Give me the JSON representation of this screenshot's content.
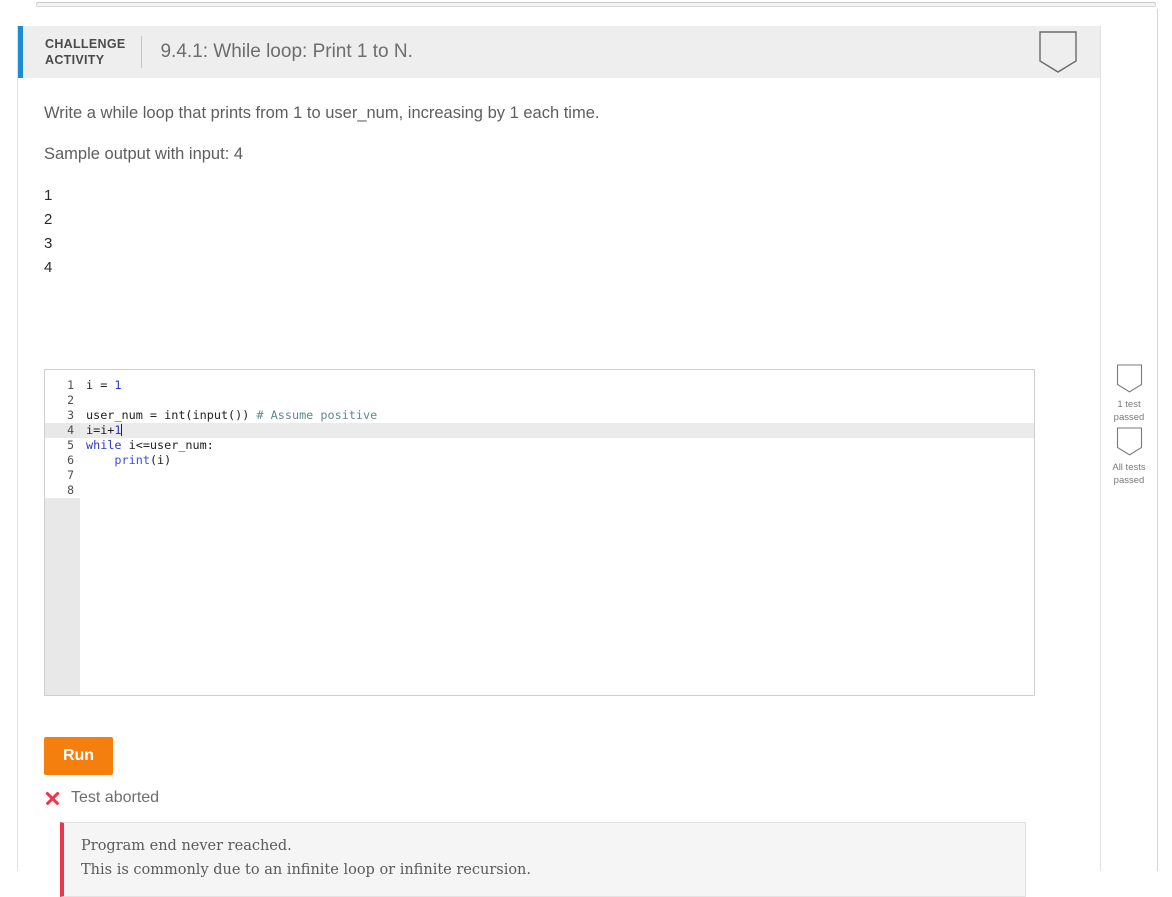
{
  "header": {
    "kicker_line1": "CHALLENGE",
    "kicker_line2": "ACTIVITY",
    "title": "9.4.1: While loop: Print 1 to N.",
    "trophy_icon": "banner-badge-icon"
  },
  "instructions": {
    "prompt": "Write a while loop that prints from 1 to user_num, increasing by 1 each time.",
    "sample_label": "Sample output with input: 4",
    "sample_output": [
      "1",
      "2",
      "3",
      "4"
    ]
  },
  "editor": {
    "line_numbers": [
      "1",
      "2",
      "3",
      "4",
      "5",
      "6",
      "7",
      "8"
    ],
    "active_line": 4,
    "lines": [
      {
        "n": 1,
        "segments": [
          {
            "t": "i = ",
            "c": "plain"
          },
          {
            "t": "1",
            "c": "num"
          }
        ]
      },
      {
        "n": 2,
        "segments": []
      },
      {
        "n": 3,
        "segments": [
          {
            "t": "user_num = int(input()) ",
            "c": "plain"
          },
          {
            "t": "# Assume positive",
            "c": "com"
          }
        ]
      },
      {
        "n": 4,
        "segments": [
          {
            "t": "i=i+",
            "c": "plain"
          },
          {
            "t": "1",
            "c": "num"
          }
        ]
      },
      {
        "n": 5,
        "segments": [
          {
            "t": "while",
            "c": "kw"
          },
          {
            "t": " i<=user_num:",
            "c": "plain"
          }
        ]
      },
      {
        "n": 6,
        "segments": [
          {
            "t": "    ",
            "c": "plain"
          },
          {
            "t": "print",
            "c": "fn"
          },
          {
            "t": "(i)",
            "c": "plain"
          }
        ]
      },
      {
        "n": 7,
        "segments": []
      },
      {
        "n": 8,
        "segments": []
      }
    ]
  },
  "toolbar": {
    "run_label": "Run"
  },
  "result": {
    "status_icon": "x-mark-icon",
    "status_text": "Test aborted",
    "error_line1": "Program end never reached.",
    "error_line2": "This is commonly due to an infinite loop or infinite recursion."
  },
  "badges": [
    {
      "icon": "banner-badge-icon",
      "line1": "1 test",
      "line2": "passed"
    },
    {
      "icon": "banner-badge-icon",
      "line1": "All tests",
      "line2": "passed"
    }
  ],
  "colors": {
    "accent_blue": "#1f8cd0",
    "run_orange": "#f47f0e",
    "error_red": "#e8384f",
    "keyword_blue": "#2b38c4",
    "comment_teal": "#5f8a8b"
  }
}
